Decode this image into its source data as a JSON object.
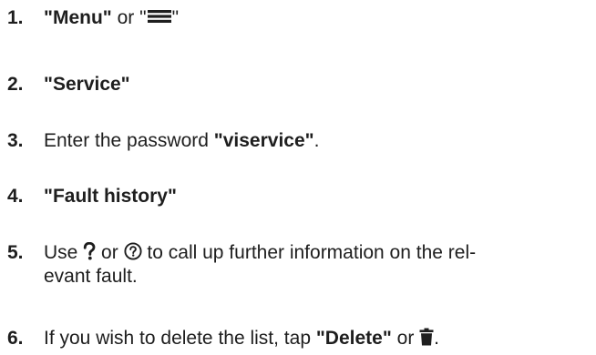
{
  "steps": [
    {
      "number": "1.",
      "menu_label": "\"Menu\"",
      "or_text": "or",
      "quote_open": "\"",
      "icon": "hamburger-menu-icon",
      "quote_close": "\""
    },
    {
      "number": "2.",
      "label": "\"Service\""
    },
    {
      "number": "3.",
      "prefix": "Enter the password",
      "password": "\"viservice\"",
      "suffix": "."
    },
    {
      "number": "4.",
      "label": "\"Fault history\""
    },
    {
      "number": "5.",
      "use_text": "Use",
      "icon_a": "question-mark-icon",
      "or_text": "or",
      "icon_b": "question-circle-icon",
      "rest_line1": "to call up further information on the rel-",
      "rest_line2": "evant fault."
    },
    {
      "number": "6.",
      "prefix": "If you wish to delete the list, tap",
      "delete_label": "\"Delete\"",
      "or_text": "or",
      "icon": "trash-icon",
      "suffix": "."
    }
  ]
}
